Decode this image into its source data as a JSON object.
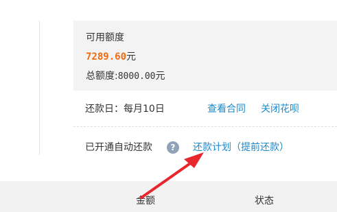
{
  "credit": {
    "available_label": "可用额度",
    "available_amount": "7289.60",
    "currency_unit": "元",
    "total_label": "总额度:",
    "total_amount": "8000.00",
    "total_unit": "元"
  },
  "repayment": {
    "date_label": "还款日：每月10日",
    "view_contract": "查看合同",
    "close_huabei": "关闭花呗"
  },
  "autopay": {
    "label": "已开通自动还款",
    "help_glyph": "?",
    "plan_link": "还款计划（提前还款）"
  },
  "table": {
    "columns": [
      "金额",
      "状态"
    ]
  },
  "colors": {
    "amount_orange": "#f26a10",
    "link_blue": "#1d8acb",
    "arrow_red": "#e8262d",
    "panel_bg": "#f3f3f3"
  }
}
